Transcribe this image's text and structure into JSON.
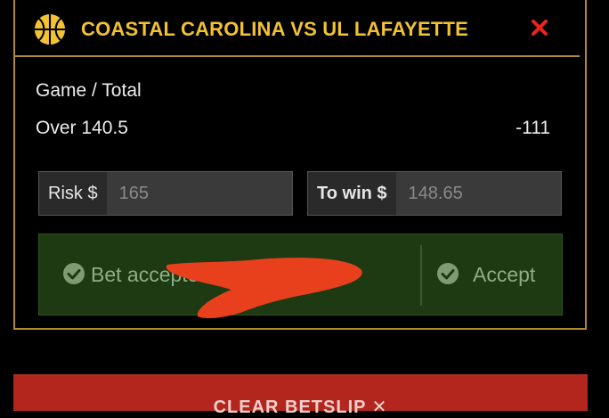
{
  "header": {
    "title": "COASTAL CAROLINA VS UL LAFAYETTE",
    "sport_icon": "basketball-icon",
    "close_icon": "close-icon",
    "accent_color": "#f2c233",
    "close_color": "#e8261c"
  },
  "bet": {
    "type": "Game / Total",
    "selection": "Over 140.5",
    "odds": "-111"
  },
  "risk": {
    "label": "Risk $",
    "value": "165"
  },
  "to_win": {
    "label": "To win $",
    "value": "148.65"
  },
  "status": {
    "accepted_text": "Bet accepted (",
    "accept_label": "Accept",
    "check_icon": "check-circle-icon",
    "background_color": "#1d3a13"
  },
  "footer": {
    "button_label": "CLEAR BETSLIP ✕",
    "button_color": "#b3261e"
  }
}
